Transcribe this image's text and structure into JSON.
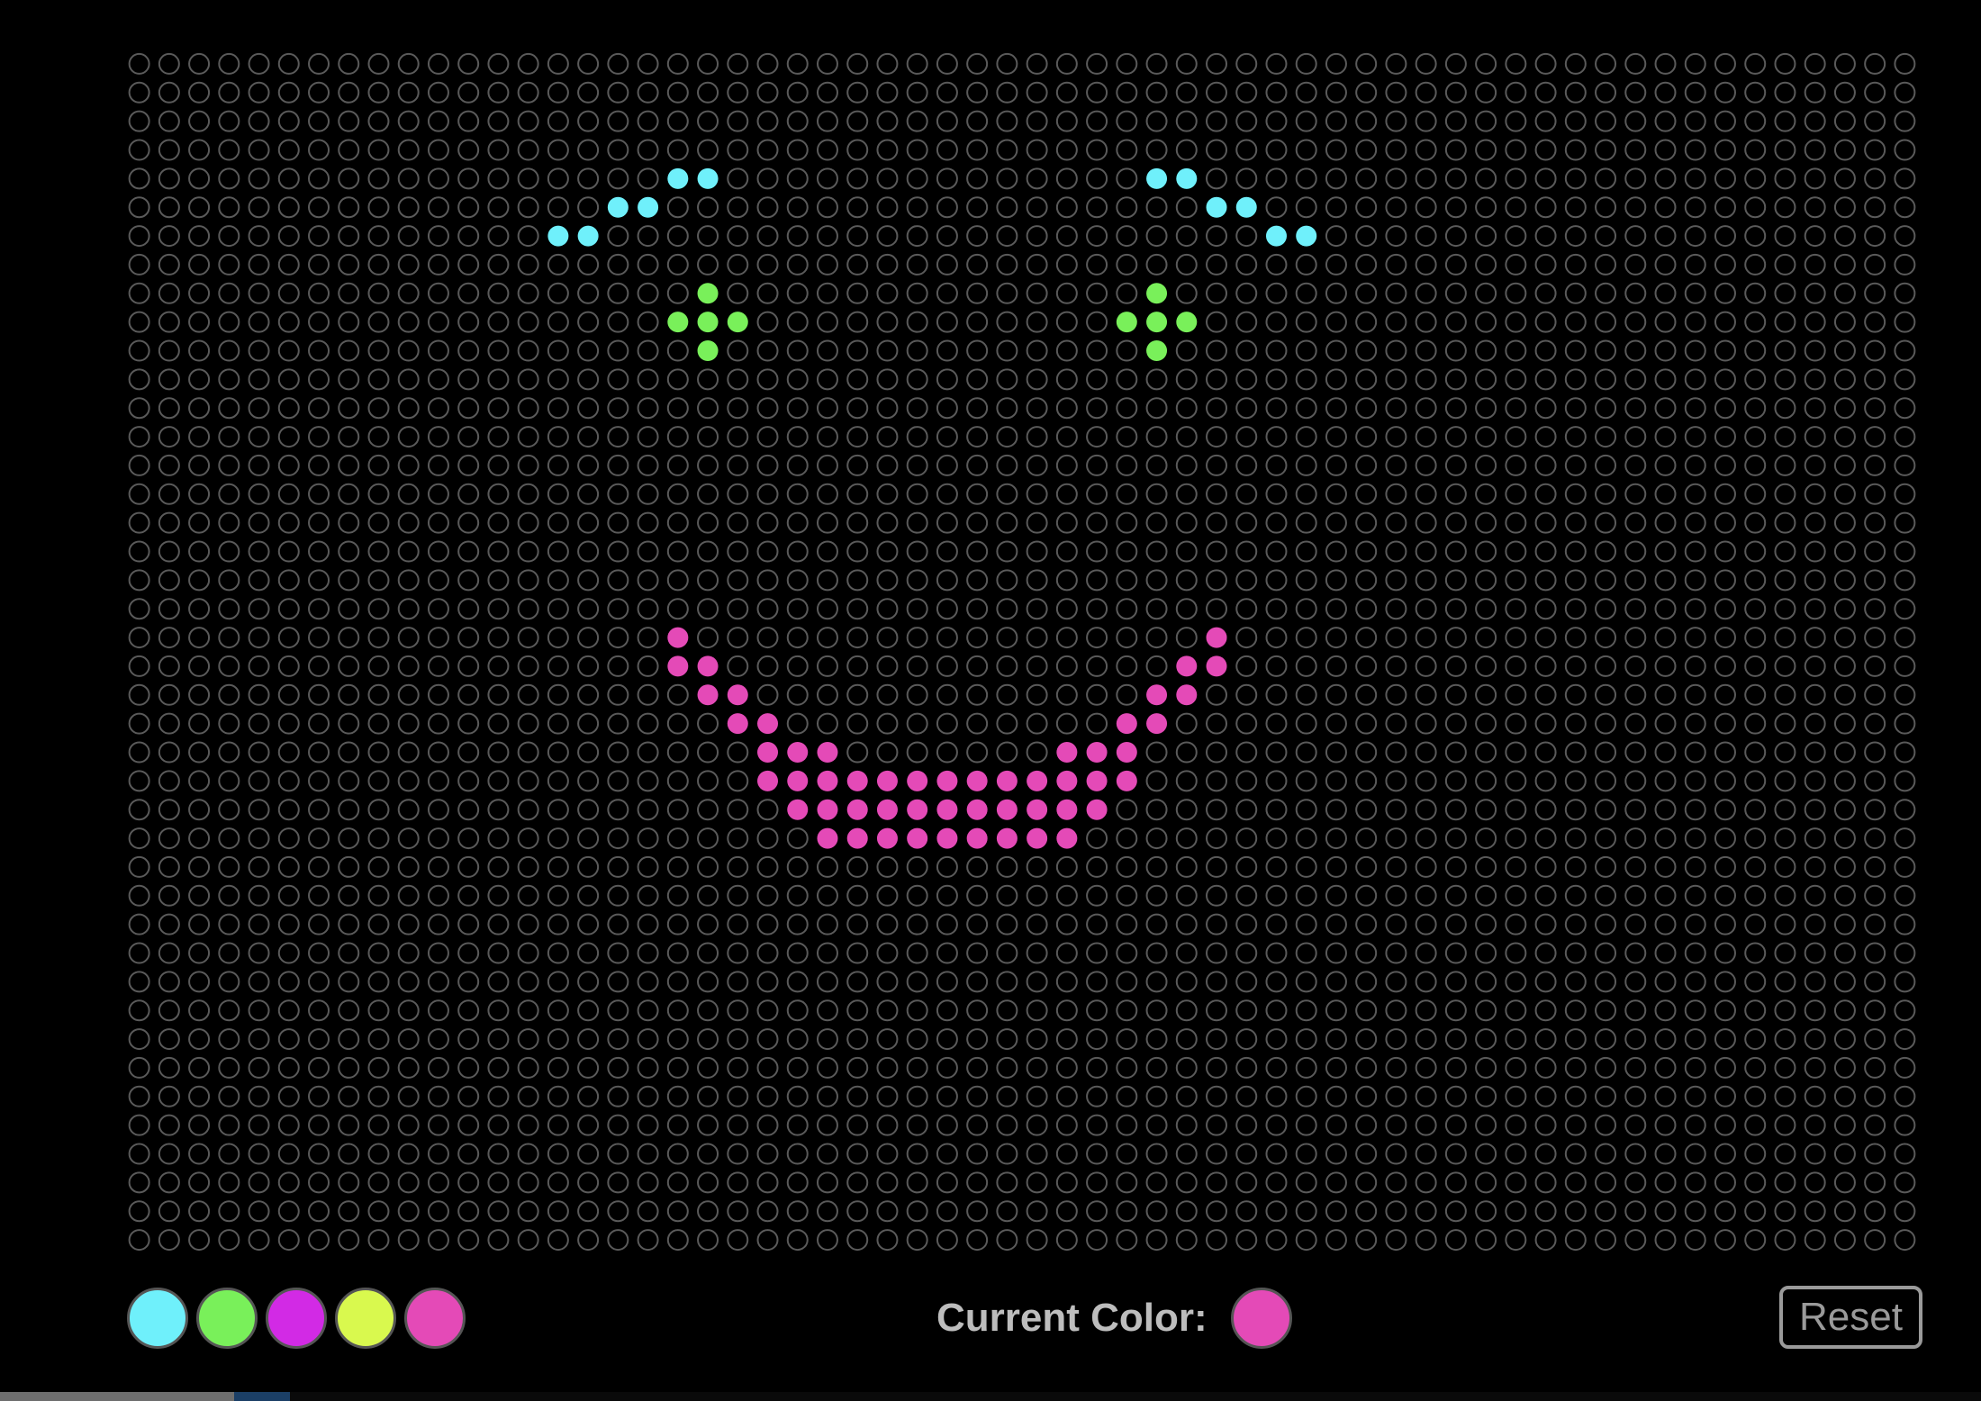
{
  "app": {
    "title": ""
  },
  "board": {
    "columns": 60,
    "rows": 42,
    "empty_peg_stroke": "#5a5a5a",
    "lit_pegs": [
      {
        "row": 4,
        "col": 18,
        "color": "cyan"
      },
      {
        "row": 4,
        "col": 19,
        "color": "cyan"
      },
      {
        "row": 5,
        "col": 16,
        "color": "cyan"
      },
      {
        "row": 5,
        "col": 17,
        "color": "cyan"
      },
      {
        "row": 6,
        "col": 14,
        "color": "cyan"
      },
      {
        "row": 6,
        "col": 15,
        "color": "cyan"
      },
      {
        "row": 4,
        "col": 34,
        "color": "cyan"
      },
      {
        "row": 4,
        "col": 35,
        "color": "cyan"
      },
      {
        "row": 5,
        "col": 36,
        "color": "cyan"
      },
      {
        "row": 5,
        "col": 37,
        "color": "cyan"
      },
      {
        "row": 6,
        "col": 38,
        "color": "cyan"
      },
      {
        "row": 6,
        "col": 39,
        "color": "cyan"
      },
      {
        "row": 8,
        "col": 19,
        "color": "green"
      },
      {
        "row": 9,
        "col": 18,
        "color": "green"
      },
      {
        "row": 9,
        "col": 19,
        "color": "green"
      },
      {
        "row": 9,
        "col": 20,
        "color": "green"
      },
      {
        "row": 10,
        "col": 19,
        "color": "green"
      },
      {
        "row": 8,
        "col": 34,
        "color": "green"
      },
      {
        "row": 9,
        "col": 33,
        "color": "green"
      },
      {
        "row": 9,
        "col": 34,
        "color": "green"
      },
      {
        "row": 9,
        "col": 35,
        "color": "green"
      },
      {
        "row": 10,
        "col": 34,
        "color": "green"
      },
      {
        "row": 20,
        "col": 18,
        "color": "pink"
      },
      {
        "row": 20,
        "col": 36,
        "color": "pink"
      },
      {
        "row": 21,
        "col": 18,
        "color": "pink"
      },
      {
        "row": 21,
        "col": 19,
        "color": "pink"
      },
      {
        "row": 21,
        "col": 35,
        "color": "pink"
      },
      {
        "row": 21,
        "col": 36,
        "color": "pink"
      },
      {
        "row": 22,
        "col": 19,
        "color": "pink"
      },
      {
        "row": 22,
        "col": 20,
        "color": "pink"
      },
      {
        "row": 22,
        "col": 34,
        "color": "pink"
      },
      {
        "row": 22,
        "col": 35,
        "color": "pink"
      },
      {
        "row": 23,
        "col": 20,
        "color": "pink"
      },
      {
        "row": 23,
        "col": 21,
        "color": "pink"
      },
      {
        "row": 23,
        "col": 33,
        "color": "pink"
      },
      {
        "row": 23,
        "col": 34,
        "color": "pink"
      },
      {
        "row": 24,
        "col": 21,
        "color": "pink"
      },
      {
        "row": 24,
        "col": 22,
        "color": "pink"
      },
      {
        "row": 24,
        "col": 23,
        "color": "pink"
      },
      {
        "row": 24,
        "col": 31,
        "color": "pink"
      },
      {
        "row": 24,
        "col": 32,
        "color": "pink"
      },
      {
        "row": 24,
        "col": 33,
        "color": "pink"
      },
      {
        "row": 25,
        "col": 21,
        "color": "pink"
      },
      {
        "row": 25,
        "col": 22,
        "color": "pink"
      },
      {
        "row": 25,
        "col": 23,
        "color": "pink"
      },
      {
        "row": 25,
        "col": 24,
        "color": "pink"
      },
      {
        "row": 25,
        "col": 25,
        "color": "pink"
      },
      {
        "row": 25,
        "col": 26,
        "color": "pink"
      },
      {
        "row": 25,
        "col": 27,
        "color": "pink"
      },
      {
        "row": 25,
        "col": 28,
        "color": "pink"
      },
      {
        "row": 25,
        "col": 29,
        "color": "pink"
      },
      {
        "row": 25,
        "col": 30,
        "color": "pink"
      },
      {
        "row": 25,
        "col": 31,
        "color": "pink"
      },
      {
        "row": 25,
        "col": 32,
        "color": "pink"
      },
      {
        "row": 25,
        "col": 33,
        "color": "pink"
      },
      {
        "row": 26,
        "col": 22,
        "color": "pink"
      },
      {
        "row": 26,
        "col": 23,
        "color": "pink"
      },
      {
        "row": 26,
        "col": 24,
        "color": "pink"
      },
      {
        "row": 26,
        "col": 25,
        "color": "pink"
      },
      {
        "row": 26,
        "col": 26,
        "color": "pink"
      },
      {
        "row": 26,
        "col": 27,
        "color": "pink"
      },
      {
        "row": 26,
        "col": 28,
        "color": "pink"
      },
      {
        "row": 26,
        "col": 29,
        "color": "pink"
      },
      {
        "row": 26,
        "col": 30,
        "color": "pink"
      },
      {
        "row": 26,
        "col": 31,
        "color": "pink"
      },
      {
        "row": 26,
        "col": 32,
        "color": "pink"
      },
      {
        "row": 27,
        "col": 23,
        "color": "pink"
      },
      {
        "row": 27,
        "col": 24,
        "color": "pink"
      },
      {
        "row": 27,
        "col": 25,
        "color": "pink"
      },
      {
        "row": 27,
        "col": 26,
        "color": "pink"
      },
      {
        "row": 27,
        "col": 27,
        "color": "pink"
      },
      {
        "row": 27,
        "col": 28,
        "color": "pink"
      },
      {
        "row": 27,
        "col": 29,
        "color": "pink"
      },
      {
        "row": 27,
        "col": 30,
        "color": "pink"
      },
      {
        "row": 27,
        "col": 31,
        "color": "pink"
      }
    ]
  },
  "palette": {
    "swatches": [
      {
        "name": "cyan",
        "hex": "#6ff0fb"
      },
      {
        "name": "green",
        "hex": "#79f05a"
      },
      {
        "name": "purple",
        "hex": "#d22ae5"
      },
      {
        "name": "lime",
        "hex": "#d9f94e"
      },
      {
        "name": "pink",
        "hex": "#e44ab7"
      }
    ]
  },
  "current": {
    "label": "Current Color:",
    "color": "#e44ab7"
  },
  "controls": {
    "reset_label": "Reset"
  }
}
